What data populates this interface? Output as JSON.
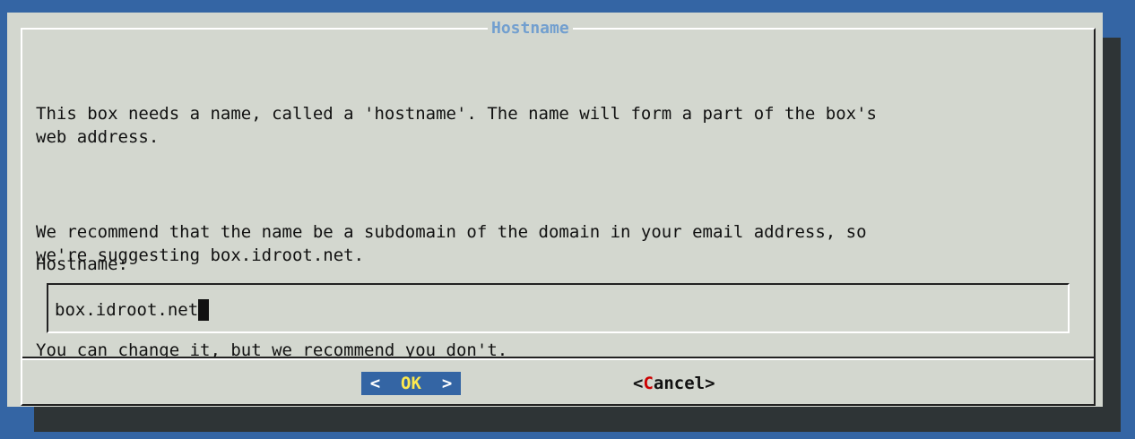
{
  "dialog": {
    "title": "Hostname",
    "paragraphs": [
      "This box needs a name, called a 'hostname'. The name will form a part of the box's\nweb address.",
      "We recommend that the name be a subdomain of the domain in your email address, so\nwe're suggesting box.idroot.net.",
      "You can change it, but we recommend you don't."
    ],
    "input_label": "Hostname:",
    "input_value": "box.idroot.net"
  },
  "buttons": {
    "ok": {
      "prefix": "<  ",
      "hotkey": "OK",
      "suffix": "  >"
    },
    "cancel": {
      "prefix": "<",
      "hotkey": "C",
      "suffix": "ancel>"
    }
  },
  "colors": {
    "desktop_background": "#3465a4",
    "dialog_background": "#d3d7cf",
    "shadow": "#2e3436",
    "title_text": "#729fcf",
    "selected_button_background": "#3465a4",
    "selected_hotkey": "#fce94f",
    "unselected_hotkey": "#cc0000"
  }
}
